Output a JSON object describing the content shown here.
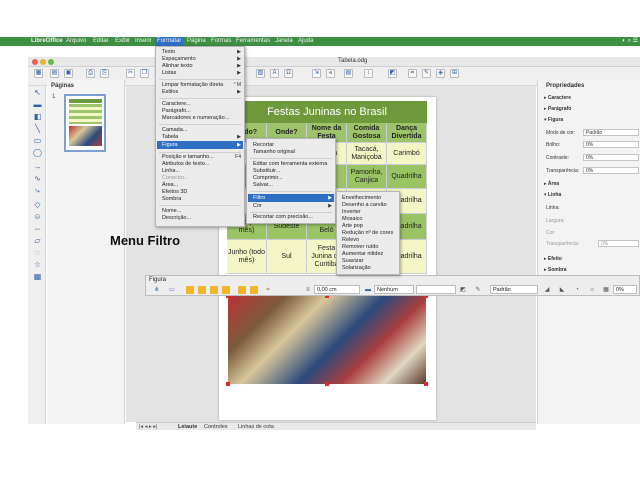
{
  "menubar": {
    "items": [
      "LibreOffice",
      "Arquivo",
      "Editar",
      "Exibir",
      "Inserir",
      "Formatar",
      "Página",
      "Formas",
      "Ferramentas",
      "Janela",
      "Ajuda"
    ],
    "active": "Formatar"
  },
  "window": {
    "doc_title": "Tabela.odg"
  },
  "slides_pane": {
    "title": "Páginas",
    "slide_number": "1"
  },
  "format_menu": {
    "items": [
      {
        "label": "Texto",
        "arrow": true
      },
      {
        "label": "Espaçamento",
        "arrow": true
      },
      {
        "label": "Alinhar texto",
        "arrow": true
      },
      {
        "label": "Listas",
        "arrow": true
      },
      {
        "label": "Limpar formatação direta",
        "shortcut": "⌃M"
      },
      {
        "label": "Estilos",
        "arrow": true
      },
      {
        "label": "Caractere..."
      },
      {
        "label": "Parágrafo..."
      },
      {
        "label": "Marcadores e numeração..."
      },
      {
        "label": "Camada..."
      },
      {
        "label": "Tabela",
        "arrow": true
      },
      {
        "label": "Figura",
        "arrow": true,
        "highlighted": true
      },
      {
        "label": "Posição e tamanho...",
        "shortcut": "F4"
      },
      {
        "label": "Atributos de texto..."
      },
      {
        "label": "Linha..."
      },
      {
        "label": "Conector...",
        "disabled": true
      },
      {
        "label": "Área..."
      },
      {
        "label": "Efeitos 3D"
      },
      {
        "label": "Sombra"
      },
      {
        "label": "Nome..."
      },
      {
        "label": "Descrição..."
      }
    ]
  },
  "figura_submenu": {
    "items": [
      {
        "label": "Recortar"
      },
      {
        "label": "Tamanho original"
      },
      {
        "label": "Editar com ferramenta externa"
      },
      {
        "label": "Substituir..."
      },
      {
        "label": "Comprimir..."
      },
      {
        "label": "Salvar..."
      },
      {
        "label": "Filtro",
        "arrow": true,
        "highlighted": true
      },
      {
        "label": "Cor",
        "arrow": true
      },
      {
        "label": "Recortar com precisão..."
      }
    ]
  },
  "filtro_submenu": {
    "items": [
      "Envelhecimento",
      "Desenho a carvão",
      "Inverter",
      "Mosaico",
      "Arte pop",
      "Redução nº de cores",
      "Relevo",
      "Remover ruído",
      "Aumentar nitidez",
      "Suavizar",
      "Solarização"
    ]
  },
  "document": {
    "table_title": "Festas Juninas no Brasil",
    "headers": [
      "ando?",
      "Onde?",
      "Nome da Festa",
      "Comida Gostosa",
      "Dança Divertida"
    ],
    "rows": [
      [
        "",
        "",
        "do tem",
        "Tacacá, Maniçoba",
        "Carimbó"
      ],
      [
        "",
        "",
        "",
        "Pamonha, Canjica",
        "Quadrilha"
      ],
      [
        "",
        "",
        "",
        "",
        "Quadrilha"
      ],
      [
        "Junho (todo mês)",
        "Sudeste",
        "Arraiá de Belô",
        "",
        "Quadrilha"
      ],
      [
        "Junho (todo mês)",
        "Sul",
        "Festa Junina de Curitiba",
        "",
        "Quadrilha"
      ]
    ]
  },
  "annotation": "Menu Filtro",
  "figura_toolbar": {
    "title": "Figura",
    "position_value": "0,00 cm",
    "line_style": "Nenhum",
    "mode": "Padrão",
    "percent": "0%"
  },
  "sidebar": {
    "title": "Propriedades",
    "sections": [
      "Caractere",
      "Parágrafo",
      "Figura",
      "Área",
      "Linha",
      "Efeito",
      "Sombra"
    ],
    "figura": {
      "mode_label": "Modo de cor:",
      "mode_value": "Padrão",
      "brightness_label": "Brilho:",
      "brightness_value": "0%",
      "contrast_label": "Contraste:",
      "contrast_value": "0%",
      "transparency_label": "Transparência:",
      "transparency_value": "0%"
    },
    "linha": {
      "line_label": "Linha:",
      "width_label": "Largura:",
      "color_label": "Cor:",
      "transparency_label": "Transparência:",
      "transparency_value": "0%"
    }
  },
  "bottom_tabs": [
    "Leiaute",
    "Controles",
    "Linhas de cota"
  ],
  "colors": {
    "menubar": "#3f8f43",
    "highlight": "#2e6fc4",
    "table_header": "#6e9a3b"
  }
}
